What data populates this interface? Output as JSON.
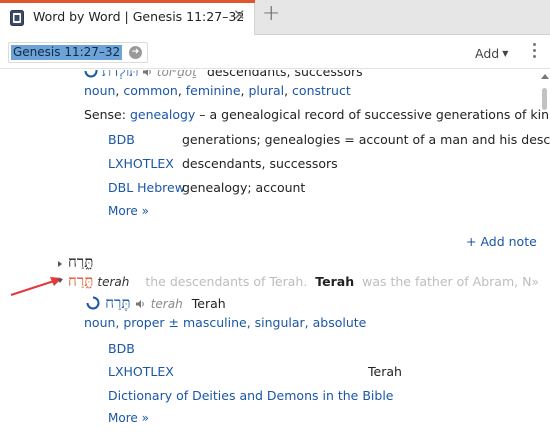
{
  "tab": {
    "title": "Word by Word | Genesis 11:27–32",
    "close": "✕",
    "add": "+"
  },
  "toolbar": {
    "reference": "Genesis 11:27–32",
    "add_label": "Add"
  },
  "entry1": {
    "hebrew": "תּוֹלְדֹת",
    "translit": "tôlᵉḏôṯ",
    "gloss": "descendants, successors",
    "pos": [
      "noun",
      "common",
      "feminine",
      "plural",
      "construct"
    ],
    "sense_label": "Sense:",
    "sense_link": "genealogy",
    "sense_text": " – a genealogical record of successive generations of kin.",
    "dictionaries": [
      {
        "name": "BDB",
        "definition": "generations; genealogies = account of a man and his desce…"
      },
      {
        "name": "LXHOTLEX",
        "definition": "descendants, successors"
      },
      {
        "name": "DBL Hebrew",
        "definition": "genealogy; account"
      }
    ],
    "more": "More »"
  },
  "add_note": "+ Add note",
  "collapsed_row": {
    "hebrew": "תָּ֑רַח"
  },
  "expanded_row": {
    "hebrew": "תָּ֑רַח",
    "translit": "terah",
    "faded_pre": "the descendants of Terah.",
    "bold_word": "Terah",
    "faded_post": "was the father of Abram, N»"
  },
  "entry2": {
    "hebrew": "תֶּרַח",
    "translit": "terah",
    "gloss": "Terah",
    "pos_text": "noun, proper ± masculine, singular, absolute",
    "dictionaries": [
      {
        "name": "BDB",
        "definition": ""
      },
      {
        "name": "LXHOTLEX",
        "definition": "Terah"
      },
      {
        "name": "Dictionary of Deities and Demons in the Bible",
        "definition": ""
      }
    ],
    "more": "More »"
  },
  "colors": {
    "accent": "#e0562d",
    "link": "#1a56a6",
    "arrow": "#e23a3a",
    "selection": "#6da3d6"
  },
  "icons": [
    "notebook-icon",
    "close-icon",
    "plus-icon",
    "go-arrow-icon",
    "chevron-down-icon",
    "more-vertical-icon",
    "speaker-icon",
    "spinner-icon",
    "disclosure-triangle-icon",
    "annotation-arrow-icon"
  ]
}
